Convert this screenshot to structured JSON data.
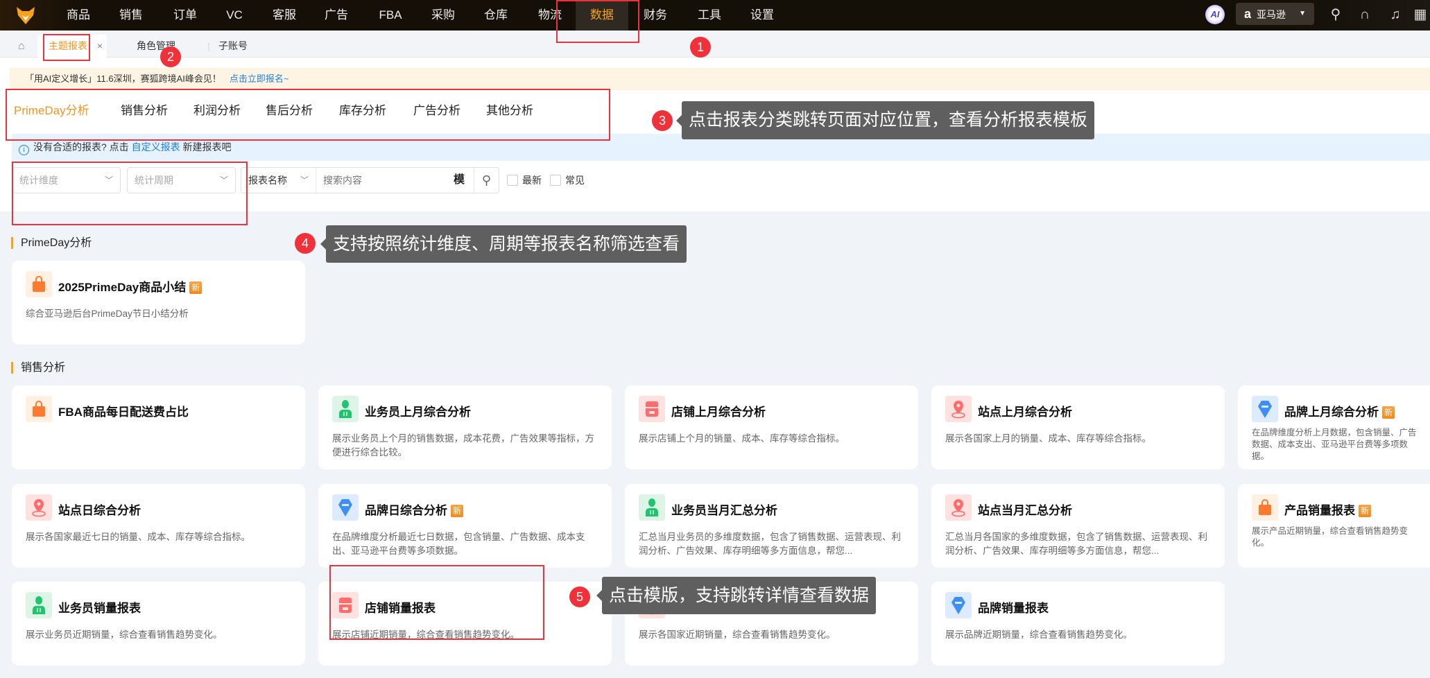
{
  "topnav": {
    "items": [
      "商品",
      "销售",
      "订单",
      "VC",
      "客服",
      "广告",
      "FBA",
      "采购",
      "仓库",
      "物流",
      "数据",
      "财务",
      "工具",
      "设置"
    ],
    "active": "数据",
    "ai_label": "AI",
    "store_selector": {
      "icon": "a",
      "label": "亚马逊"
    }
  },
  "tabs": {
    "items": [
      "主题报表",
      "角色管理",
      "子账号"
    ],
    "close": "×"
  },
  "banner": {
    "text": "「用AI定义增长」11.6深圳，赛狐跨境AI峰会见！",
    "link": "点击立即报名~"
  },
  "categories": [
    "PrimeDay分析",
    "销售分析",
    "利润分析",
    "售后分析",
    "库存分析",
    "广告分析",
    "其他分析"
  ],
  "info": {
    "prefix": "没有合适的报表? 点击",
    "link": "自定义报表",
    "suffix": "新建报表吧"
  },
  "filters": {
    "dimension_placeholder": "统计维度",
    "period_placeholder": "统计周期",
    "field": "报表名称",
    "search_placeholder": "搜索内容",
    "search_value_label": "模",
    "checkbox_latest": "最新",
    "checkbox_common": "常见"
  },
  "sections": {
    "primeday": {
      "title": "PrimeDay分析",
      "cards": [
        {
          "title": "2025PrimeDay商品小结",
          "new": "新",
          "desc": "综合亚马逊后台PrimeDay节日小结分析"
        }
      ]
    },
    "sales": {
      "title": "销售分析",
      "cards": [
        {
          "title": "FBA商品每日配送费占比",
          "desc": ""
        },
        {
          "title": "业务员上月综合分析",
          "desc": "展示业务员上个月的销售数据，成本花费，广告效果等指标，方便进行综合比较。"
        },
        {
          "title": "店铺上月综合分析",
          "desc": "展示店铺上个月的销量、成本、库存等综合指标。"
        },
        {
          "title": "站点上月综合分析",
          "desc": "展示各国家上月的销量、成本、库存等综合指标。"
        },
        {
          "title": "品牌上月综合分析",
          "new": "新",
          "desc": "在品牌维度分析上月数据，包含销量、广告数据、成本支出、亚马逊平台费等多项数据。"
        },
        {
          "title": "站点日综合分析",
          "desc": "展示各国家最近七日的销量、成本、库存等综合指标。"
        },
        {
          "title": "品牌日综合分析",
          "new": "新",
          "desc": "在品牌维度分析最近七日数据，包含销量、广告数据、成本支出、亚马逊平台费等多项数据。"
        },
        {
          "title": "业务员当月汇总分析",
          "desc": "汇总当月业务员的多维度数据，包含了销售数据、运营表现、利润分析、广告效果、库存明细等多方面信息，帮您..."
        },
        {
          "title": "站点当月汇总分析",
          "desc": "汇总当月各国家的多维度数据，包含了销售数据、运营表现、利润分析、广告效果、库存明细等多方面信息，帮您..."
        },
        {
          "title": "产品销量报表",
          "new": "新",
          "desc": "展示产品近期销量，综合查看销售趋势变化。"
        },
        {
          "title": "业务员销量报表",
          "desc": "展示业务员近期销量，综合查看销售趋势变化。"
        },
        {
          "title": "店铺销量报表",
          "desc": "展示店铺近期销量，综合查看销售趋势变化。"
        },
        {
          "title": "站点销量报表",
          "desc": "展示各国家近期销量，综合查看销售趋势变化。"
        },
        {
          "title": "品牌销量报表",
          "desc": "展示品牌近期销量，综合查看销售趋势变化。"
        }
      ]
    }
  },
  "annotations": {
    "n1": "1",
    "n2": "2",
    "n3": "3",
    "n4": "4",
    "n5": "5",
    "tip3": "点击报表分类跳转页面对应位置，查看分析报表模板",
    "tip4": "支持按照统计维度、周期等报表名称筛选查看",
    "tip5": "点击模版，支持跳转详情查看数据"
  },
  "colors": {
    "accent": "#f7931e",
    "link": "#1e7ee8",
    "annotation": "#f0313a"
  }
}
